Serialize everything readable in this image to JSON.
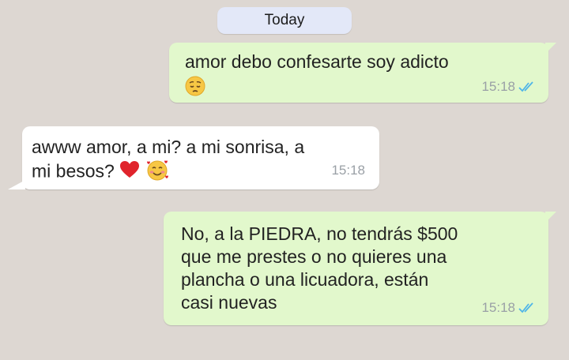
{
  "date_separator": "Today",
  "messages": [
    {
      "direction": "outgoing",
      "text": "amor debo confesarte soy adicto",
      "emoji": [
        "pensive-face"
      ],
      "time": "15:18",
      "status": "read"
    },
    {
      "direction": "incoming",
      "text_line1": "awww amor, a mi? a mi sonrisa, a",
      "text_line2": "mi besos?",
      "emoji": [
        "red-heart",
        "smiling-face-with-hearts"
      ],
      "time": "15:18"
    },
    {
      "direction": "outgoing",
      "lines": [
        "No, a la PIEDRA, no tendrás $500",
        "que me prestes o no quieres una",
        "plancha o una licuadora, están",
        "casi nuevas"
      ],
      "time": "15:18",
      "status": "read"
    }
  ],
  "colors": {
    "background": "#ddd7d2",
    "outgoing_bubble": "#e2f8cc",
    "incoming_bubble": "#ffffff",
    "read_ticks": "#4fb5e8",
    "timestamp": "#9aa0a6"
  }
}
